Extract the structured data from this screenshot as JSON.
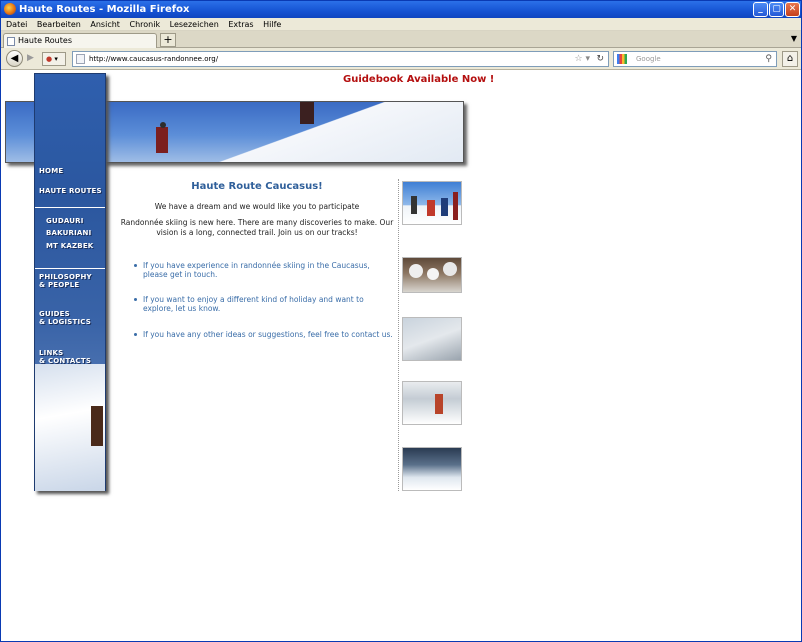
{
  "window": {
    "title": "Haute Routes - Mozilla Firefox"
  },
  "menu": [
    "Datei",
    "Bearbeiten",
    "Ansicht",
    "Chronik",
    "Lesezeichen",
    "Extras",
    "Hilfe"
  ],
  "tab": {
    "title": "Haute Routes",
    "new_tab": "+"
  },
  "url": "http://www.caucasus-randonnee.org/",
  "search": {
    "engine": "Google",
    "placeholder": "Google"
  },
  "page": {
    "guidebook": "Guidebook Available Now !",
    "nav": {
      "home": "HOME",
      "haute_routes": "HAUTE ROUTES",
      "gudauri": "GUDAURI",
      "bakuriani": "BAKURIANI",
      "mt_kazbek": "MT KAZBEK",
      "philosophy": "PHILOSOPHY\n& PEOPLE",
      "guides": "GUIDES\n& LOGISTICS",
      "links": "LINKS\n& CONTACTS"
    },
    "heading": "Haute Route Caucasus!",
    "intro1": "We have a dream and we would like you to participate",
    "intro2": "Randonnée skiing is new here. There are many discoveries to make. Our vision is a long, connected trail. Join us on our tracks!",
    "bullets": [
      "If you have experience in randonnée skiing in the Caucasus, please get in touch.",
      "If you want to enjoy a different kind of holiday and want to explore, let us know.",
      "If you have any other ideas or suggestions, feel free to contact us."
    ]
  },
  "colors": {
    "heading": "#2f5f9a",
    "link": "#3a6da8",
    "guidebook": "#b40f0f",
    "sidebar": "#2b579f"
  }
}
